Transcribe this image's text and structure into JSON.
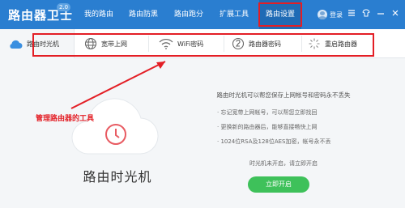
{
  "app": {
    "title": "路由器卫士",
    "version": "2.0",
    "login_label": "登录"
  },
  "nav": {
    "items": [
      {
        "label": "我的路由"
      },
      {
        "label": "路由防黑"
      },
      {
        "label": "路由跑分"
      },
      {
        "label": "扩展工具"
      },
      {
        "label": "路由设置"
      }
    ],
    "active_index": 4
  },
  "tools": {
    "items": [
      {
        "label": "路由时光机",
        "icon": "cloud-icon"
      },
      {
        "label": "宽带上网",
        "icon": "globe-icon"
      },
      {
        "label": "WiFi密码",
        "icon": "wifi-icon"
      },
      {
        "label": "路由器密码",
        "icon": "key-icon"
      },
      {
        "label": "重启路由器",
        "icon": "restart-icon"
      }
    ],
    "active_index": 0
  },
  "main": {
    "product_title": "路由时光机",
    "annotation": "管理路由器的工具",
    "info_heading": "路由时光机可以帮您保存上网帐号和密码永不丢失",
    "bullets": [
      "· 忘记宽带上网帐号，可以帮您立即找回",
      "· 更换新的路由器后，能够直接畅快上网",
      "· 1024位RSA及128位AES加密，帐号永不丢"
    ],
    "note": "时光机未开启，请立即开启",
    "start_button": "立即开启"
  },
  "colors": {
    "topbar": "#2a7ed0",
    "nav_active": "#1f6bb5",
    "highlight_red": "#e31e25",
    "button_green": "#3ec15a"
  }
}
